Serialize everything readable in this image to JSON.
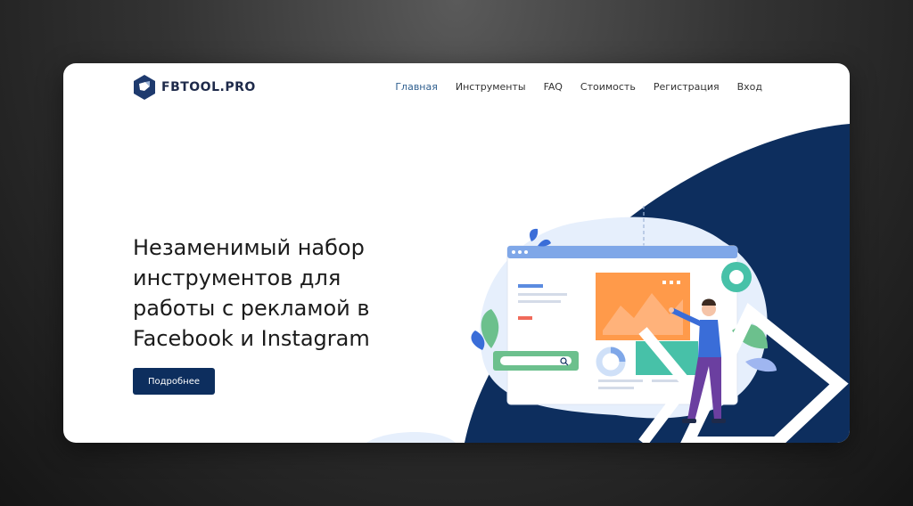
{
  "brand": {
    "name": "FBTOOL",
    "tld": ".PRO"
  },
  "nav": {
    "items": [
      {
        "label": "Главная",
        "active": true
      },
      {
        "label": "Инструменты",
        "active": false
      },
      {
        "label": "FAQ",
        "active": false
      },
      {
        "label": "Стоимость",
        "active": false
      },
      {
        "label": "Регистрация",
        "active": false
      },
      {
        "label": "Вход",
        "active": false
      }
    ]
  },
  "hero": {
    "title_lines": [
      "Незаменимый набор",
      "инструментов для",
      "работы с рекламой в",
      "Facebook и Instagram"
    ],
    "cta_label": "Подробнее"
  },
  "colors": {
    "navy": "#0d2e5e",
    "nav_active": "#2f5f8f",
    "orange": "#ff9a4a",
    "teal": "#47c1a8",
    "light_blue": "#e6effc"
  },
  "illustration": {
    "icons": [
      "browser-window-icon",
      "search-bar-icon",
      "chart-card-icon",
      "person-figure-icon",
      "plant-leaf-icon",
      "gear-icon"
    ]
  }
}
